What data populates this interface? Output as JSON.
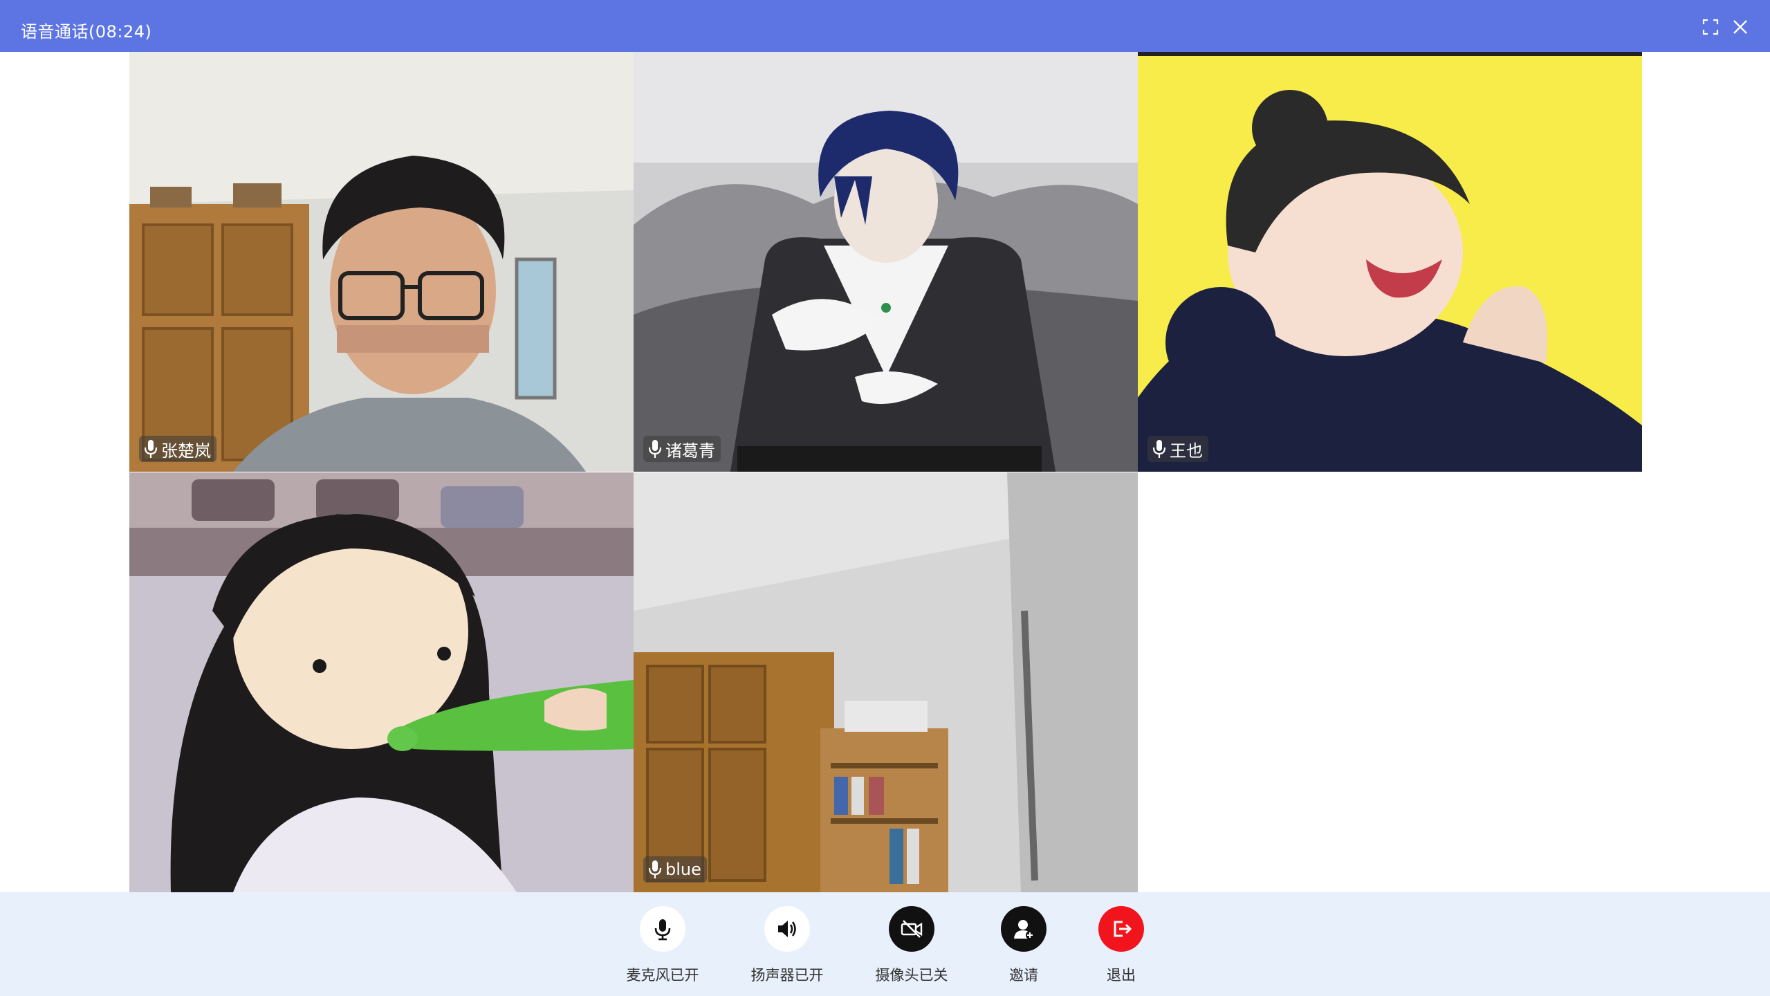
{
  "window": {
    "title": "语音通话(08:24)",
    "accent_color": "#5d75e3"
  },
  "participants": [
    {
      "name": "张楚岚",
      "mic_icon": "microphone-icon"
    },
    {
      "name": "诸葛青",
      "mic_icon": "microphone-icon"
    },
    {
      "name": "王也",
      "mic_icon": "microphone-icon"
    },
    {
      "name": "",
      "mic_icon": "none"
    },
    {
      "name": "blue",
      "mic_icon": "microphone-icon"
    }
  ],
  "controls": {
    "mic": {
      "label": "麦克风已开",
      "icon": "microphone-icon"
    },
    "speaker": {
      "label": "扬声器已开",
      "icon": "speaker-icon"
    },
    "camera": {
      "label": "摄像头已关",
      "icon": "camera-off-icon"
    },
    "invite": {
      "label": "邀请",
      "icon": "add-user-icon"
    },
    "exit": {
      "label": "退出",
      "icon": "exit-icon",
      "color": "#f2141c"
    }
  }
}
